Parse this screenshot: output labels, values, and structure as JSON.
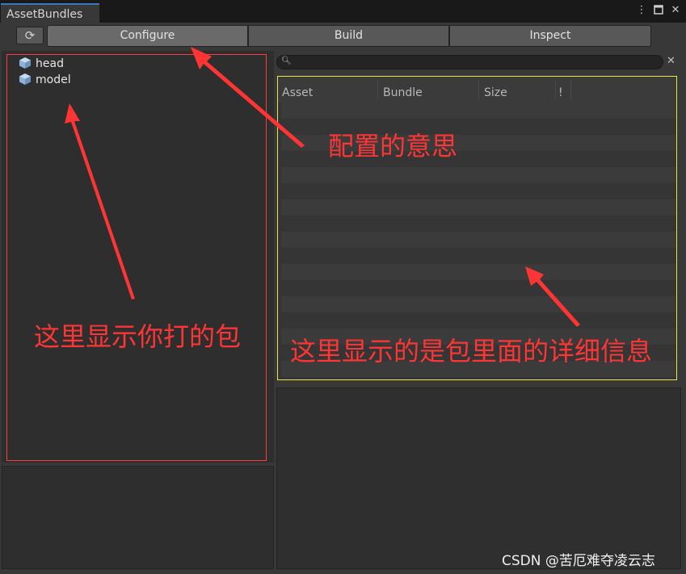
{
  "window": {
    "tab_title": "AssetBundles",
    "icons": [
      "more-vert-icon",
      "maximize-icon",
      "close-icon"
    ]
  },
  "toolbar": {
    "refresh_icon": "refresh-icon",
    "tabs": [
      {
        "label": "Configure",
        "active": true
      },
      {
        "label": "Build",
        "active": false
      },
      {
        "label": "Inspect",
        "active": false
      }
    ]
  },
  "tree": {
    "items": [
      {
        "label": "head",
        "icon": "cube-icon"
      },
      {
        "label": "model",
        "icon": "cube-icon"
      }
    ]
  },
  "search": {
    "placeholder": "",
    "value": ""
  },
  "table": {
    "columns": [
      "Asset",
      "Bundle",
      "Size",
      "!"
    ],
    "rows": []
  },
  "annotations": {
    "configure_note": "配置的意思",
    "tree_note": "这里显示你打的包",
    "table_note": "这里显示的是包里面的详细信息"
  },
  "watermark": "CSDN @苦厄难夺凌云志",
  "colors": {
    "annotation_red": "#ff3535",
    "table_highlight": "#e7e745",
    "tab_accent": "#3a79bb"
  }
}
